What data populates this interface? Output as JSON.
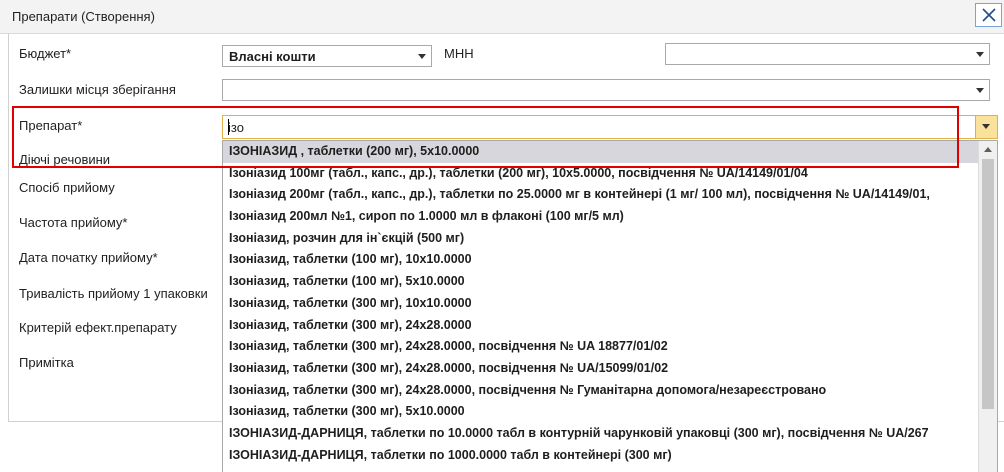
{
  "window": {
    "title": "Препарати (Створення)"
  },
  "labels": {
    "budget": "Бюджет*",
    "mnn": "МНН",
    "storage": "Залишки місця зберігання",
    "preparat": "Препарат*",
    "substances": "Діючі речовини",
    "method": "Спосіб прийому",
    "frequency": "Частота прийому*",
    "start_date": "Дата початку прийому*",
    "duration": "Тривалість прийому 1 упаковки",
    "criterion": "Критерій ефект.препарату",
    "note": "Примітка"
  },
  "fields": {
    "budget_value": "Власні кошти",
    "mnn_value": "",
    "storage_value": "",
    "preparat_value": "ізо"
  },
  "dropdown": {
    "items": [
      "ІЗОНІАЗИД , таблетки (200 мг), 5x10.0000",
      "Ізоніазид 100мг (табл., капс., др.), таблетки (200 мг), 10x5.0000, посвідчення № UA/14149/01/04",
      "Ізоніазид 200мг (табл., капс., др.), таблетки по 25.0000 мг в контейнері (1 мг/ 100 мл), посвідчення № UA/14149/01,",
      "Ізоніазид 200мл №1, сироп по 1.0000 мл в флаконі (100 мг/5 мл)",
      "Ізоніазид, розчин для ін`єкцій (500 мг)",
      "Ізоніазид, таблетки (100 мг), 10x10.0000",
      "Ізоніазид, таблетки (100 мг), 5x10.0000",
      "Ізоніазид, таблетки (300 мг), 10x10.0000",
      "Ізоніазид, таблетки (300 мг), 24x28.0000",
      "Ізоніазид, таблетки (300 мг), 24x28.0000, посвідчення № UA 18877/01/02",
      "Ізоніазид, таблетки (300 мг), 24x28.0000, посвідчення № UA/15099/01/02",
      "Ізоніазид, таблетки (300 мг), 24x28.0000, посвідчення № Гуманітарна допомога/незареєстровано",
      "Ізоніазид, таблетки (300 мг), 5x10.0000",
      "ІЗОНІАЗИД-ДАРНИЦЯ, таблетки по 10.0000 табл в контурній чарунковій упаковці (300 мг), посвідчення № UA/267",
      "ІЗОНІАЗИД-ДАРНИЦЯ, таблетки по 1000.0000 табл в контейнері (300 мг)"
    ]
  },
  "colors": {
    "highlight": "#e00000",
    "focused_border": "#e2b04a",
    "dropdown_button": "#fbe29c",
    "selected_item": "#d6d6dc"
  },
  "icons": {
    "close": "close-icon",
    "dropdown": "chevron-down-icon",
    "scroll_up": "scroll-up-icon"
  }
}
